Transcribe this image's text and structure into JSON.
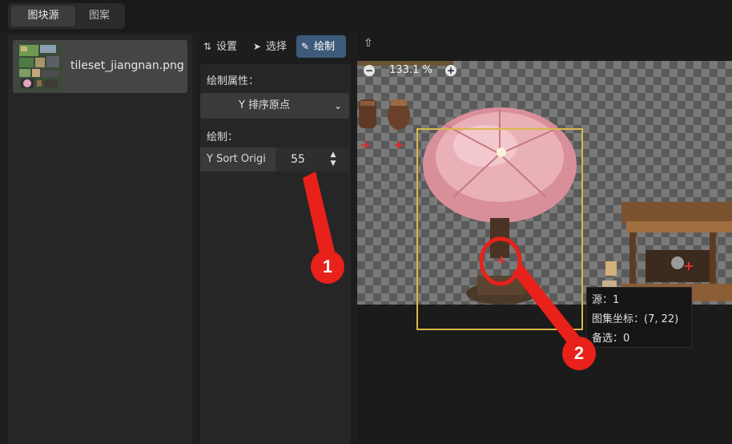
{
  "top_tabs": [
    {
      "label": "图块源",
      "active": true
    },
    {
      "label": "图案",
      "active": false
    }
  ],
  "source_list": {
    "items": [
      {
        "name": "tileset_jiangnan.png",
        "selected": true
      }
    ]
  },
  "toolbar": {
    "settings_label": "设置",
    "select_label": "选择",
    "paint_label": "绘制",
    "active_tool": "paint"
  },
  "properties": {
    "paint_props_heading": "绘制属性：",
    "dropdown_selected": "Y 排序原点",
    "paint_heading": "绘制：",
    "field_label": "Y Sort Origi",
    "field_value": "55"
  },
  "canvas": {
    "zoom_out_symbol": "−",
    "zoom_value": "133.1 %",
    "zoom_in_symbol": "+",
    "tooltip": {
      "line1": "源：1",
      "line2": "图集坐标：(7, 22)",
      "line3": "备选：0"
    }
  },
  "annotations": {
    "badge1": "1",
    "badge2": "2",
    "color": "#e8211a"
  },
  "colors": {
    "accent": "#3d5a7a",
    "highlight": "#d9b84a",
    "marker": "#e03030"
  },
  "icons": [
    "settings-icon",
    "cursor-icon",
    "brush-icon",
    "pin-icon",
    "chevron-down-icon",
    "spin-arrows-icon",
    "zoom-out-icon",
    "zoom-in-icon"
  ]
}
